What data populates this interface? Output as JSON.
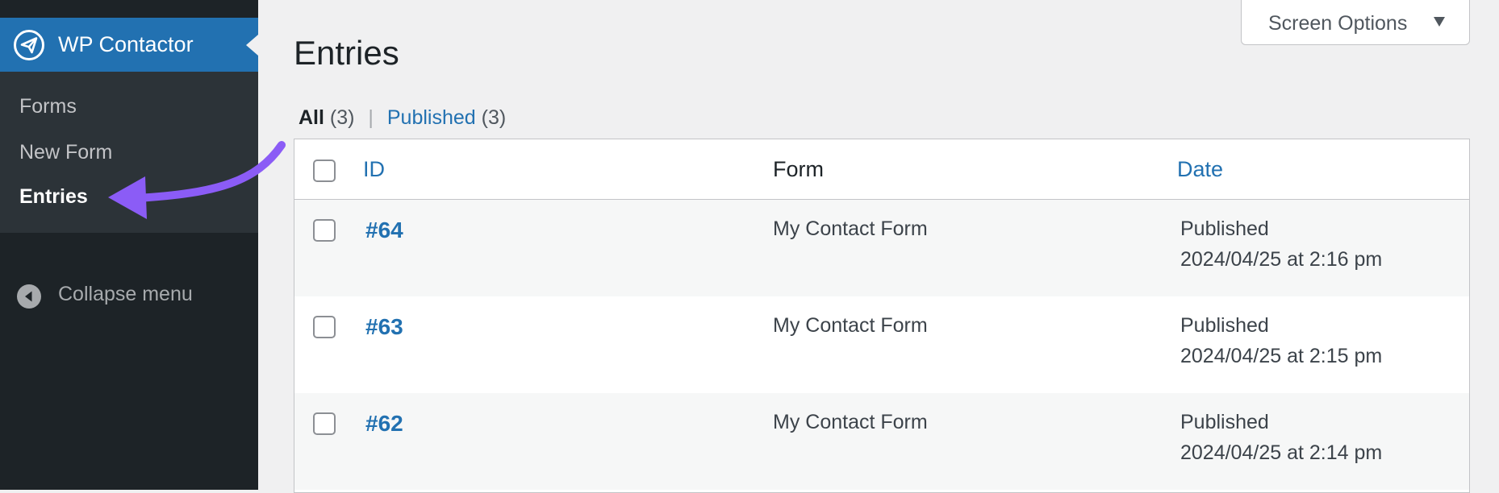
{
  "sidebar": {
    "plugin_name": "WP Contactor",
    "items": [
      {
        "label": "Forms"
      },
      {
        "label": "New Form"
      },
      {
        "label": "Entries"
      }
    ],
    "collapse_label": "Collapse menu"
  },
  "header": {
    "screen_options_label": "Screen Options",
    "title": "Entries"
  },
  "filters": {
    "all_label": "All",
    "all_count": "(3)",
    "separator": "|",
    "published_label": "Published",
    "published_count": "(3)"
  },
  "table": {
    "columns": [
      "ID",
      "Form",
      "Date"
    ],
    "rows": [
      {
        "id": "#64",
        "form": "My Contact Form",
        "status": "Published",
        "date": "2024/04/25 at 2:16 pm"
      },
      {
        "id": "#63",
        "form": "My Contact Form",
        "status": "Published",
        "date": "2024/04/25 at 2:15 pm"
      },
      {
        "id": "#62",
        "form": "My Contact Form",
        "status": "Published",
        "date": "2024/04/25 at 2:14 pm"
      }
    ]
  },
  "colors": {
    "sidebar_bg": "#1d2327",
    "accent": "#2271b1",
    "annotation_arrow": "#8b5cf6"
  },
  "icons": {
    "plugin_logo": "paper-plane-icon",
    "collapse": "collapse-arrow-icon",
    "screen_options": "triangle-down-icon"
  }
}
